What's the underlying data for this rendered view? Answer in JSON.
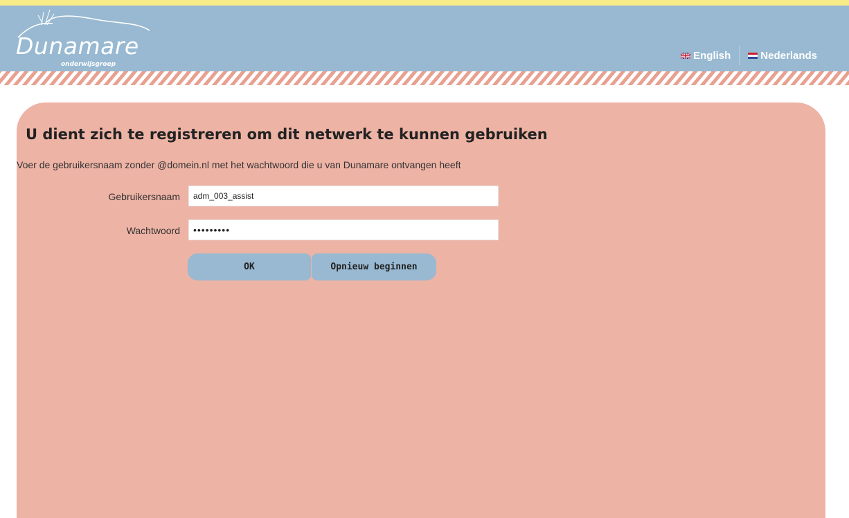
{
  "header": {
    "logo_title": "Dunamare",
    "logo_subtitle": "onderwijsgroep",
    "languages": [
      {
        "label": "English",
        "flag": "uk-flag-icon"
      },
      {
        "label": "Nederlands",
        "flag": "nl-flag-icon"
      }
    ]
  },
  "form": {
    "title": "U dient zich te registreren om dit netwerk te kunnen gebruiken",
    "intro": "Voer de gebruikersnaam zonder @domein.nl met het wachtwoord die u van Dunamare ontvangen heeft",
    "username_label": "Gebruikersnaam",
    "username_value": "adm_003_assist",
    "password_label": "Wachtwoord",
    "password_value": "assist123",
    "ok_label": "OK",
    "reset_label": "Opnieuw beginnen"
  },
  "colors": {
    "top_strip": "#f7ec87",
    "header": "#98b9d1",
    "panel": "#edb3a5",
    "button": "#98b9d1"
  }
}
